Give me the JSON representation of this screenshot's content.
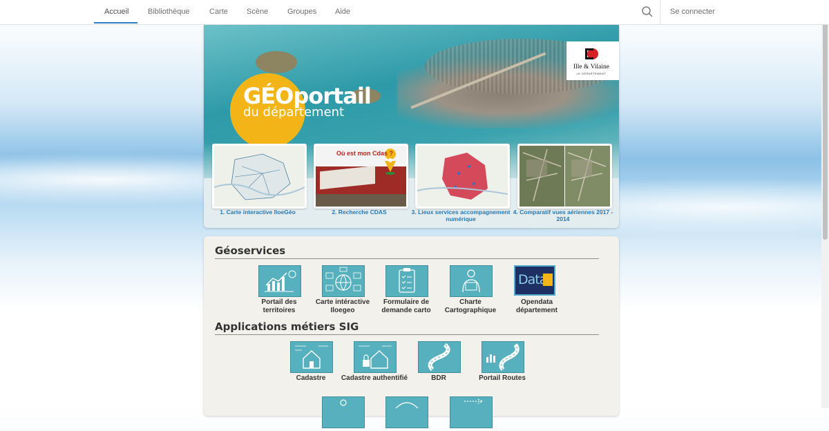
{
  "nav": {
    "items": [
      {
        "label": "Accueil",
        "active": true
      },
      {
        "label": "Bibliothèque"
      },
      {
        "label": "Carte"
      },
      {
        "label": "Scène"
      },
      {
        "label": "Groupes"
      },
      {
        "label": "Aide"
      }
    ],
    "search_icon": "search-icon",
    "signin_label": "Se connecter"
  },
  "hero": {
    "logo_title": "GÉOportail",
    "logo_subtitle": "du département",
    "badge_title": "Ille & Vilaine",
    "badge_sub": "LE DÉPARTEMENT",
    "cards": [
      {
        "caption": "1. Carte interactive IloeGéo",
        "image_text": ""
      },
      {
        "caption": "2. Recherche CDAS",
        "image_text": "Où est mon Cdas ?"
      },
      {
        "caption": "3. Lieux services accompagnement numérique",
        "image_text": ""
      },
      {
        "caption": "4. Comparatif vues aériennes 2017 - 2014",
        "image_text": ""
      }
    ]
  },
  "sections": [
    {
      "title": "Géoservices",
      "tiles": [
        {
          "label": "Portail des territoires",
          "icon": "chart-icon"
        },
        {
          "label": "Carte intéractive Iloegeo",
          "icon": "globe-map-icon"
        },
        {
          "label": "Formulaire de demande carto",
          "icon": "clipboard-icon"
        },
        {
          "label": "Charte Cartographique",
          "icon": "person-document-icon"
        },
        {
          "label": "Opendata département",
          "icon": "opendata-logo"
        }
      ]
    },
    {
      "title": "Applications métiers SIG",
      "tiles": [
        {
          "label": "Cadastre",
          "icon": "house-icon"
        },
        {
          "label": "Cadastre authentifié",
          "icon": "house-lock-icon"
        },
        {
          "label": "BDR",
          "icon": "road-icon"
        },
        {
          "label": "Portail Routes",
          "icon": "road-chart-icon"
        }
      ]
    }
  ],
  "opendata_text": "Data",
  "colors": {
    "tile": "#57b0bd",
    "accent": "#2d7fc1",
    "caption": "#2577b5",
    "logo": "#f2b416"
  }
}
